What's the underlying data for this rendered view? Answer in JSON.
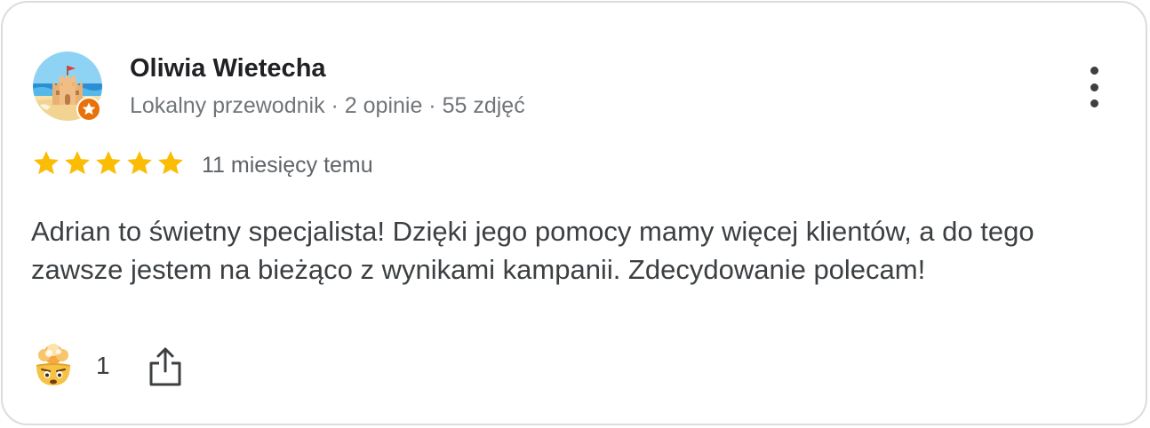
{
  "review": {
    "author": {
      "name": "Oliwia Wietecha",
      "meta": "Lokalny przewodnik · 2 opinie · 55 zdjęć",
      "avatar_icon": "sandcastle-avatar",
      "badge_icon": "local-guide-star-badge"
    },
    "rating": 5,
    "rating_max": 5,
    "time": "11 miesięcy temu",
    "text": "Adrian to świetny specjalista! Dzięki jego pomocy mamy więcej klientów, a do tego zawsze jestem na bieżąco z wynikami kampanii. Zdecydowanie polecam!",
    "reactions": {
      "emoji_icon": "mind-blown-emoji-icon",
      "count": "1"
    },
    "actions": {
      "more_icon": "more-vertical-icon",
      "share_icon": "share-icon"
    }
  },
  "colors": {
    "star": "#fbbc04",
    "badge": "#e8710a",
    "text_primary": "#202124",
    "text_secondary": "#70757a",
    "border": "#dcdcdc"
  }
}
